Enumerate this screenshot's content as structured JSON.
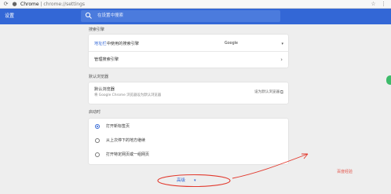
{
  "addressbar": {
    "site_label": "Chrome",
    "url_path": "chrome://settings"
  },
  "header": {
    "title": "设置",
    "search_placeholder": "在设置中搜索"
  },
  "search_engine": {
    "section_label": "搜索引擎",
    "row1_link": "地址栏",
    "row1_text": "中使用的搜索引擎",
    "row1_value": "Google",
    "row2_text": "管理搜索引擎"
  },
  "default_browser": {
    "section_label": "默认浏览器",
    "title": "默认浏览器",
    "subtitle": "将 Google Chrome 浏览器设为默认浏览器",
    "action": "设为默认浏览器"
  },
  "on_startup": {
    "section_label": "启动时",
    "options": [
      {
        "label": "打开新标签页",
        "checked": true
      },
      {
        "label": "从上次停下的地方继续",
        "checked": false
      },
      {
        "label": "打开特定网页或一组网页",
        "checked": false
      }
    ]
  },
  "advanced": {
    "label": "高级"
  },
  "annotation": {
    "watermark": "百度经验",
    "color": "#e23a2e"
  },
  "colors": {
    "header": "#3367d6",
    "accent": "#3367d6",
    "background": "#eeeeee"
  }
}
